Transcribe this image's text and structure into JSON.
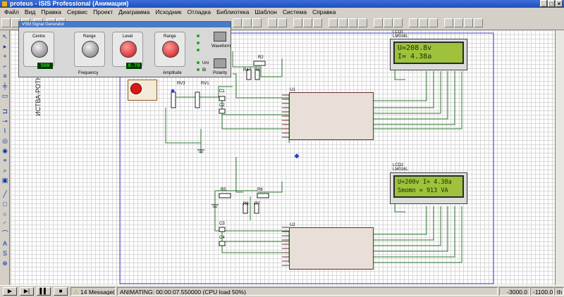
{
  "window": {
    "title": "proteus - ISIS Professional (Анимация)",
    "controls": [
      "_",
      "□",
      "×"
    ]
  },
  "menu": {
    "items": [
      "Файл",
      "Вид",
      "Правка",
      "Сервис",
      "Проект",
      "Диаграмма",
      "Исходник",
      "Отладка",
      "Библиотека",
      "Шаблон",
      "Система",
      "Справка"
    ]
  },
  "signal_generator": {
    "title": "VSM Signal Generator",
    "centre_label": "Centre",
    "range_label": "Range",
    "level_label": "Level",
    "frequency_label": "Frequency",
    "amplitude_label": "Amplitude",
    "centre_value": "500",
    "level_value": "0.70",
    "waveform_label": "Waveform",
    "polarity_label": "Polarity",
    "uni_label": "Uni",
    "bi_label": "Bi"
  },
  "schematic": {
    "vertical_title": "ИСТВА-РОТН",
    "lcd1": {
      "ref": "LCD1",
      "part": "LM016L",
      "line1": "U=208.8v",
      "line2": "I= 4.38a"
    },
    "lcd2": {
      "ref": "LCD2",
      "part": "LM016L",
      "line1": "U=200v  I= 4.38a",
      "line2": "Smomn =  913 VA"
    },
    "u1": "U1",
    "u2": "U2",
    "parts": [
      "R1",
      "R2",
      "R3",
      "R4",
      "R5",
      "R6",
      "R7",
      "R8",
      "RV1",
      "RV3",
      "C1",
      "C2",
      "C3",
      "C4"
    ]
  },
  "status": {
    "messages": "14 Message(s)",
    "animating": "ANIMATING: 00:00:07.550000 (CPU load 50%)",
    "coord_x": "-3000.0",
    "coord_y": "-1100.0",
    "unit": "th"
  },
  "colors": {
    "lcd_bg": "#9ec23b",
    "chip_border": "#6a2a2a",
    "wire": "#2f7a2f",
    "sheet_border": "#3a3ad8"
  }
}
